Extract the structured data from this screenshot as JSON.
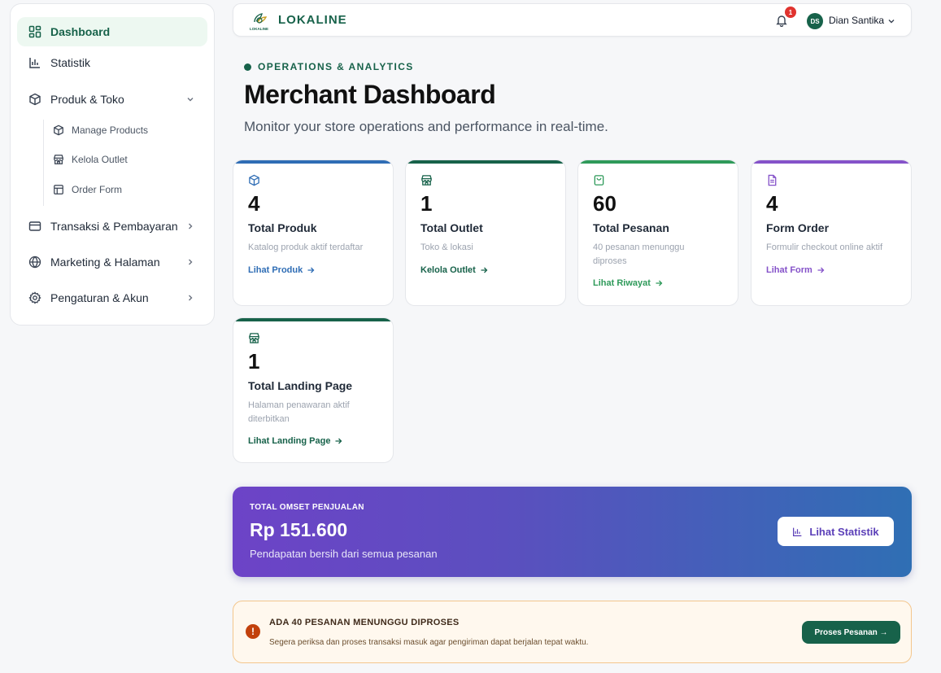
{
  "sidebar": {
    "items": [
      {
        "label": "Dashboard",
        "icon": "grid-icon"
      },
      {
        "label": "Statistik",
        "icon": "bar-chart-icon"
      },
      {
        "label": "Produk & Toko",
        "icon": "box-icon"
      },
      {
        "label": "Transaksi & Pembayaran",
        "icon": "credit-card-icon"
      },
      {
        "label": "Marketing & Halaman",
        "icon": "globe-icon"
      },
      {
        "label": "Pengaturan & Akun",
        "icon": "gear-icon"
      }
    ],
    "sub_items": [
      {
        "label": "Manage Products",
        "icon": "box-icon"
      },
      {
        "label": "Kelola Outlet",
        "icon": "store-icon"
      },
      {
        "label": "Order Form",
        "icon": "layout-icon"
      }
    ]
  },
  "header": {
    "brand": "LOKALINE",
    "logo_text": "LOKALINE",
    "notification_count": "1",
    "avatar_initials": "DS",
    "user_name": "Dian Santika"
  },
  "page": {
    "eyebrow": "OPERATIONS & ANALYTICS",
    "title": "Merchant Dashboard",
    "subtitle": "Monitor your store operations and performance in real-time."
  },
  "stats": [
    {
      "value": "4",
      "label": "Total Produk",
      "desc": "Katalog produk aktif terdaftar",
      "link": "Lihat Produk",
      "color": "#2f6db5",
      "icon": "box-icon"
    },
    {
      "value": "1",
      "label": "Total Outlet",
      "desc": "Toko & lokasi",
      "link": "Kelola Outlet",
      "color": "#17624a",
      "icon": "store-icon"
    },
    {
      "value": "60",
      "label": "Total Pesanan",
      "desc": "40 pesanan menunggu diproses",
      "link": "Lihat Riwayat",
      "color": "#2f9a5a",
      "icon": "shopping-bag-icon"
    },
    {
      "value": "4",
      "label": "Form Order",
      "desc": "Formulir checkout online aktif",
      "link": "Lihat Form",
      "color": "#8552c9",
      "icon": "document-icon"
    },
    {
      "value": "1",
      "label": "Total Landing Page",
      "desc": "Halaman penawaran aktif diterbitkan",
      "link": "Lihat Landing Page",
      "color": "#17624a",
      "icon": "store-icon"
    }
  ],
  "revenue": {
    "label": "TOTAL OMSET PENJUALAN",
    "value": "Rp 151.600",
    "desc": "Pendapatan bersih dari semua pesanan",
    "button": "Lihat Statistik"
  },
  "alert": {
    "title": "ADA 40 PESANAN MENUNGGU DIPROSES",
    "desc": "Segera periksa dan proses transaksi masuk agar pengiriman dapat berjalan tepat waktu.",
    "button": "Proses Pesanan →"
  }
}
